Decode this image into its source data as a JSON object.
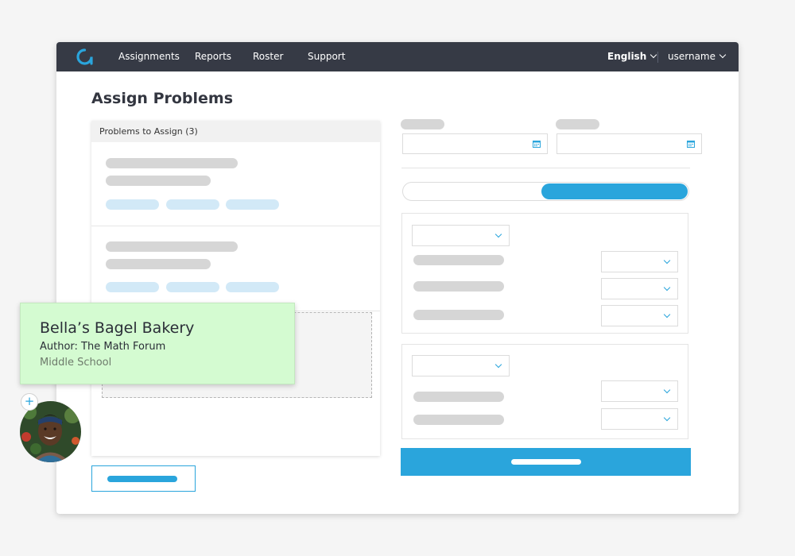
{
  "nav": {
    "items": [
      "Assignments",
      "Reports",
      "Roster",
      "Support"
    ],
    "language": "English",
    "username": "username"
  },
  "page": {
    "title": "Assign Problems"
  },
  "problems_panel": {
    "header": "Problems to Assign (3)"
  },
  "drag_card": {
    "title": "Bella’s Bagel Bakery",
    "author": "Author: The Math Forum",
    "level": "Middle School"
  },
  "badge": {
    "plus": "+"
  },
  "colors": {
    "nav_bg": "#363a45",
    "accent": "#2aa5dc",
    "drag_card_bg": "#d4fbd1",
    "placeholder": "#d6d6d6",
    "placeholder_blue": "#d2e9f7"
  },
  "icons": {
    "logo": "app-logo",
    "calendar": "calendar-icon",
    "chevron": "chevron-down-icon",
    "plus": "plus-icon"
  }
}
